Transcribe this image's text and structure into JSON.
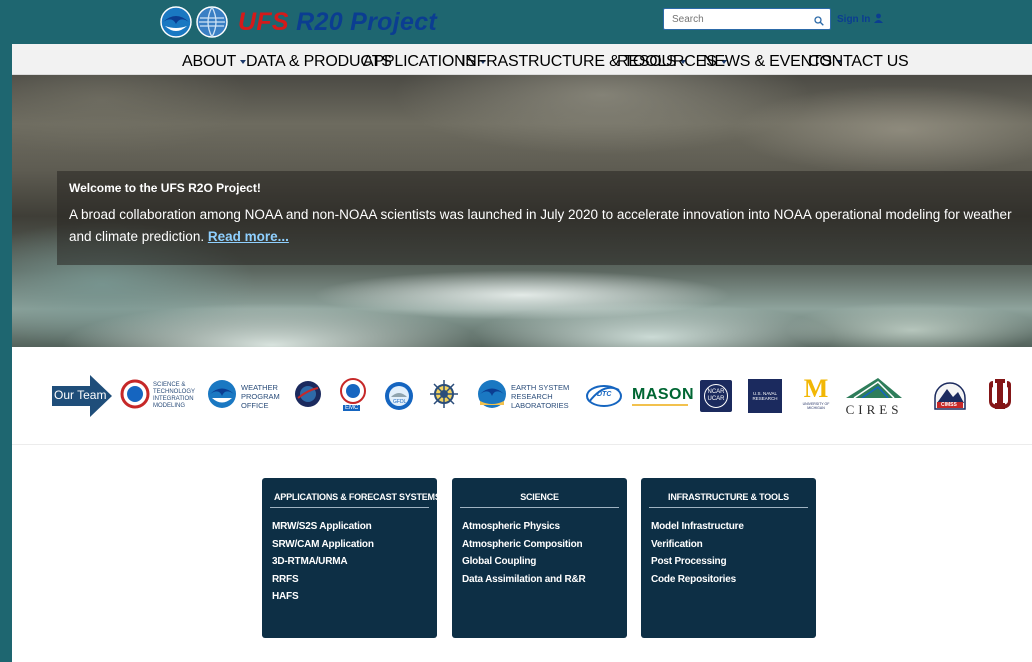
{
  "header": {
    "title_ufs": "UFS",
    "title_rest": "R20 Project",
    "search_placeholder": "Search",
    "signin_label": "Sign In"
  },
  "nav": {
    "items": [
      {
        "label": "ABOUT",
        "dropdown": true
      },
      {
        "label": "DATA & PRODUCTS",
        "dropdown": false
      },
      {
        "label": "APPLICATIONS",
        "dropdown": true
      },
      {
        "label": "INFRASTRUCTURE & TOOLS",
        "dropdown": true
      },
      {
        "label": "RESOURCES",
        "dropdown": true
      },
      {
        "label": "NEWS & EVENTS",
        "dropdown": true
      },
      {
        "label": "CONTACT US",
        "dropdown": false
      }
    ]
  },
  "hero": {
    "title": "Welcome to the UFS R2O Project!",
    "text": "A broad collaboration among NOAA and non-NOAA scientists was launched in July 2020 to accelerate innovation into NOAA operational modeling for weather and climate prediction.",
    "read_more": "Read more..."
  },
  "team": {
    "arrow_label": "Our Team",
    "partners": [
      {
        "icon": "nws-sti-logo",
        "text": "SCIENCE & TECHNOLOGY INTEGRATION MODELING"
      },
      {
        "icon": "noaa-wpo-logo",
        "text": "WEATHER PROGRAM OFFICE"
      },
      {
        "icon": "nasa-logo",
        "text": ""
      },
      {
        "icon": "emc-logo",
        "text": "EMC"
      },
      {
        "icon": "gfdl-logo",
        "text": "GFDL"
      },
      {
        "icon": "compass-logo",
        "text": ""
      },
      {
        "icon": "noaa-esrl-logo",
        "text": "EARTH SYSTEM RESEARCH LABORATORIES"
      },
      {
        "icon": "dtc-logo",
        "text": "DTC"
      },
      {
        "icon": "gmu-logo",
        "text": "MASON"
      },
      {
        "icon": "ncar-logo",
        "text": "NCAR UCAR"
      },
      {
        "icon": "nrl-logo",
        "text": "U.S. NAVAL RESEARCH"
      },
      {
        "icon": "umich-logo",
        "text": "UNIVERSITY OF MICHIGAN"
      },
      {
        "icon": "cires-logo",
        "text": "CIRES"
      },
      {
        "icon": "cimss-logo",
        "text": "CIMSS"
      },
      {
        "icon": "ou-logo",
        "text": ""
      }
    ]
  },
  "cards": [
    {
      "title": "APPLICATIONS & FORECAST SYSTEMS",
      "items": [
        "MRW/S2S Application",
        "SRW/CAM Application",
        "3D-RTMA/URMA",
        "RRFS",
        "HAFS"
      ]
    },
    {
      "title": "SCIENCE",
      "items": [
        "Atmospheric Physics",
        "Atmospheric Composition",
        "Global Coupling",
        "Data Assimilation and R&R"
      ]
    },
    {
      "title": "INFRASTRUCTURE & TOOLS",
      "items": [
        "Model Infrastructure",
        "Verification",
        "Post Processing",
        "Code Repositories"
      ]
    }
  ],
  "colors": {
    "frame_teal": "#1e6670",
    "brand_navy": "#0b3d91",
    "brand_red": "#d41a1a",
    "card_bg": "#0d2f45",
    "link_blue": "#8fd0ff"
  }
}
